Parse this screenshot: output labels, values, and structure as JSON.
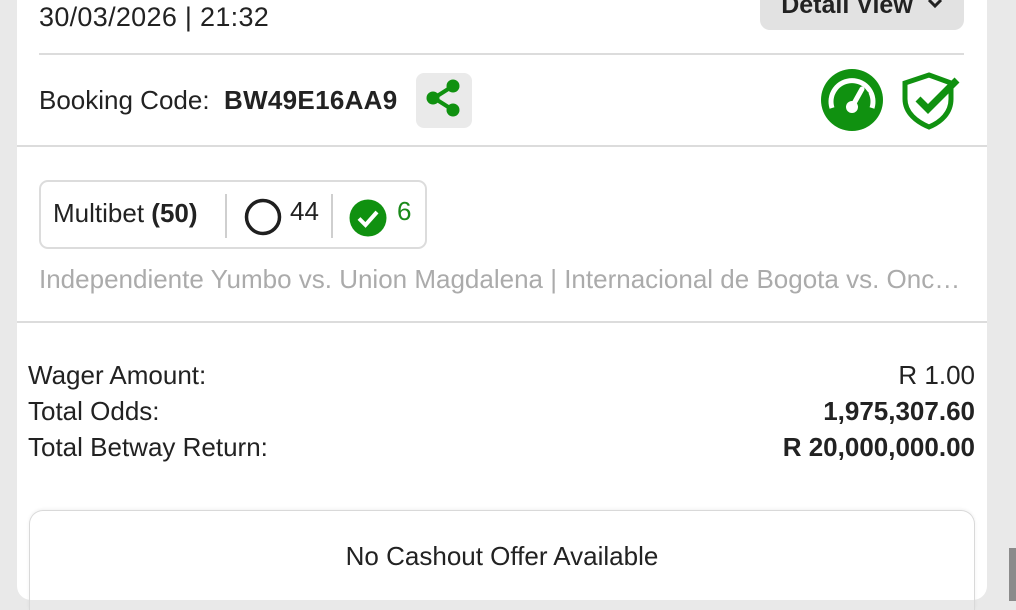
{
  "bet": {
    "datetime": "30/03/2026 | 21:32",
    "detail_view_label": "Detail View",
    "booking_label": "Booking Code:",
    "booking_code": "BW49E16AA9"
  },
  "multibet": {
    "label": "Multibet",
    "total": "(50)",
    "open_count": "44",
    "won_count": "6",
    "matches": "Independiente Yumbo vs. Union Magdalena | Internacional de Bogota vs. Once Caldas"
  },
  "summary": {
    "wager_label": "Wager Amount:",
    "wager_value": "R 1.00",
    "odds_label": "Total Odds:",
    "odds_value": "1,975,307.60",
    "return_label": "Total Betway Return:",
    "return_value": "R 20,000,000.00"
  },
  "cashout": {
    "text": "No Cashout Offer Available"
  },
  "icons": {
    "share": "share-icon",
    "gauge": "speedometer-icon",
    "shield": "shield-check-icon",
    "open": "circle-outline-icon",
    "won": "check-circle-icon",
    "chevron": "chevron-down-icon"
  },
  "colors": {
    "accent_green": "#109110",
    "won_green": "#1a8a1a",
    "muted_text": "#ababab"
  }
}
